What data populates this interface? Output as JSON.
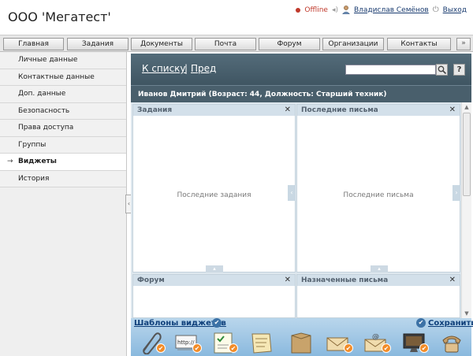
{
  "app": {
    "title": "ООО 'Мегатест'"
  },
  "user": {
    "status": "Offline",
    "name": "Владислав Семёнов",
    "logout": "Выход"
  },
  "nav": {
    "tabs": [
      "Главная",
      "Задания",
      "Документы",
      "Почта",
      "Форум",
      "Организации",
      "Контакты"
    ],
    "more": "»"
  },
  "sidebar": {
    "items": [
      "Личные данные",
      "Контактные данные",
      "Доп. данные",
      "Безопасность",
      "Права доступа",
      "Группы",
      "Виджеты",
      "История"
    ],
    "active": "Виджеты",
    "active_marker": "→"
  },
  "toolbar": {
    "back": "К списку",
    "separator": "|",
    "prev": "Пред",
    "search_value": "",
    "help": "?"
  },
  "person": {
    "info": "Иванов Дмитрий (Возраст: 44, Должность: Старший техник)"
  },
  "widgets": [
    {
      "title": "Задания",
      "empty_text": "Последние задания"
    },
    {
      "title": "Последние письма",
      "empty_text": "Последние письма"
    },
    {
      "title": "Форум",
      "empty_text": ""
    },
    {
      "title": "Назначенные письма",
      "empty_text": ""
    }
  ],
  "close_glyph": "✕",
  "templates": {
    "label": "Шаблоны виджетов",
    "save": "Сохранить",
    "check_glyph": "✔"
  },
  "template_icons": [
    "paperclip-icon",
    "url-icon",
    "task-list-icon",
    "note-icon",
    "folder-icon",
    "mail-icon",
    "email-at-icon",
    "monitor-icon",
    "phone-icon"
  ],
  "colors": {
    "accent": "#3f5562",
    "link": "#1a3c70",
    "offline": "#c0392b",
    "badge": "#f28c28"
  }
}
